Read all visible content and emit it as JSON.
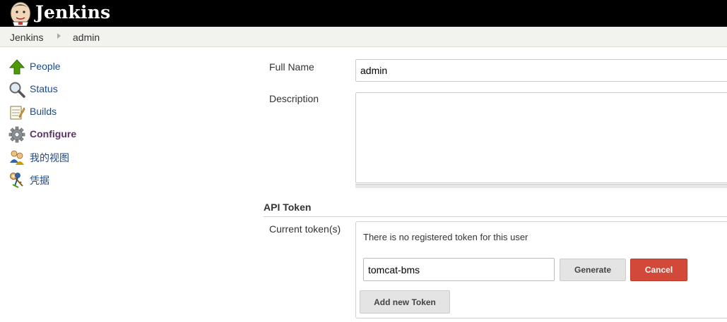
{
  "header": {
    "brand": "Jenkins",
    "logo_icon": "jenkins-butler-logo"
  },
  "breadcrumb": [
    "Jenkins",
    "admin"
  ],
  "sidebar": {
    "items": [
      {
        "label": "People",
        "icon": "up-arrow-people-icon",
        "active": false
      },
      {
        "label": "Status",
        "icon": "magnifier-status-icon",
        "active": false
      },
      {
        "label": "Builds",
        "icon": "notepad-builds-icon",
        "active": false
      },
      {
        "label": "Configure",
        "icon": "gear-configure-icon",
        "active": true
      },
      {
        "label": "我的视图",
        "icon": "users-view-icon",
        "active": false
      },
      {
        "label": "凭据",
        "icon": "keys-credentials-icon",
        "active": false
      }
    ]
  },
  "form": {
    "full_name_label": "Full Name",
    "full_name_value": "admin",
    "description_label": "Description",
    "description_value": ""
  },
  "api_token": {
    "section_title": "API Token",
    "current_tokens_label": "Current token(s)",
    "no_token_message": "There is no registered token for this user",
    "token_name_value": "tomcat-bms",
    "generate_label": "Generate",
    "cancel_label": "Cancel",
    "add_new_label": "Add new Token"
  },
  "colors": {
    "header_bg": "#000000",
    "link": "#204a87",
    "active_link": "#5c3566",
    "cancel_bg": "#d24939"
  }
}
